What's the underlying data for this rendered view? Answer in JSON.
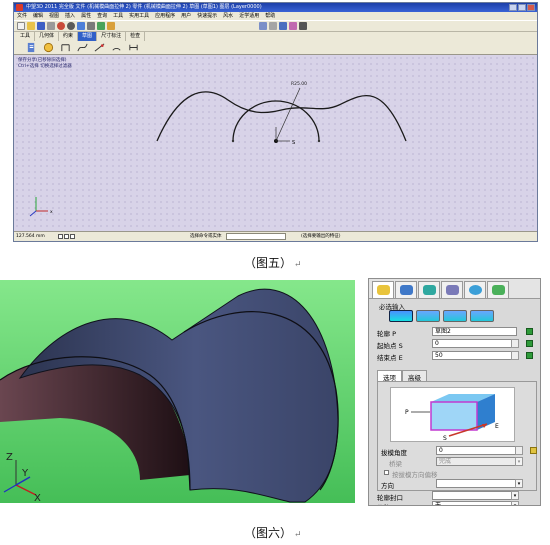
{
  "fig5": {
    "title": "中望3D 2011 完全版      文件 (机械模曲面拉伸 2)    零件 (机械模曲面拉伸 2)   草图 (草图1)  图层 (Layer0000)",
    "menu": [
      "文件",
      "编辑",
      "视图",
      "插入",
      "属性",
      "查询",
      "工具",
      "实用工具",
      "应用程序",
      "用户",
      "快速提示",
      "风水",
      "近学适用",
      "帮助"
    ],
    "tabs": [
      "工具",
      "几何体",
      "约束",
      "草图",
      "尺寸标注",
      "检查"
    ],
    "active_tab": "草图",
    "hint_line1": "保存分享(已移除旧选择)",
    "hint_line2": "Ctrl+选择 切换选择过滤器",
    "dimension": "R25.00",
    "axis_label": "S",
    "canvas_axis_x": "x",
    "status_coord": "127.564 mm",
    "status_prompt": "选择命令或实体",
    "status_right": "(选择要输出的特征)",
    "toolbar_icons": [
      "new-icon",
      "open-icon",
      "save-icon",
      "print-icon",
      "undo-icon",
      "redo-icon",
      "zoom-icon",
      "rotate-icon",
      "pan-icon",
      "fit-icon",
      "shade-icon",
      "wireframe-icon",
      "layer-icon",
      "color-icon",
      "settings-icon"
    ],
    "sketch_icons": [
      "profile-icon",
      "circle-icon",
      "line-icon",
      "spline-icon",
      "arc-icon",
      "trim-icon",
      "dimension-icon"
    ],
    "colors": {
      "titlebar": "#2a4fc0",
      "canvas": "#d8d3e8",
      "curve": "#1a1a1a"
    }
  },
  "caption5": "（图五）",
  "caption6": "（图六）",
  "caption_mark": "↵",
  "fig6": {
    "axis_z": "Z",
    "axis_y": "Y",
    "axis_x": "X",
    "colors": {
      "background": "#58cd68",
      "surface_outer": "#434f78",
      "surface_inner": "#3a1c24"
    },
    "panel": {
      "required": "必选输入",
      "profile_label": "轮廓 P",
      "profile_value": "草图2",
      "start_label": "起始点 S",
      "start_value": "0",
      "end_label": "结束点 E",
      "end_value": "50",
      "option_tabs": [
        "选项",
        "高级"
      ],
      "active_option": "选项",
      "preview_p": "P",
      "preview_s": "S",
      "preview_e": "E",
      "draft_label": "拔模角度",
      "draft_value": "0",
      "bevel_label": "桥梁",
      "bevel_value": "完成",
      "reverse_label": "按拔模方向偏移",
      "direction_label": "方向",
      "profile_cap_label": "轮廓封口",
      "offset_label": "偏移",
      "offset_value": "无"
    }
  }
}
